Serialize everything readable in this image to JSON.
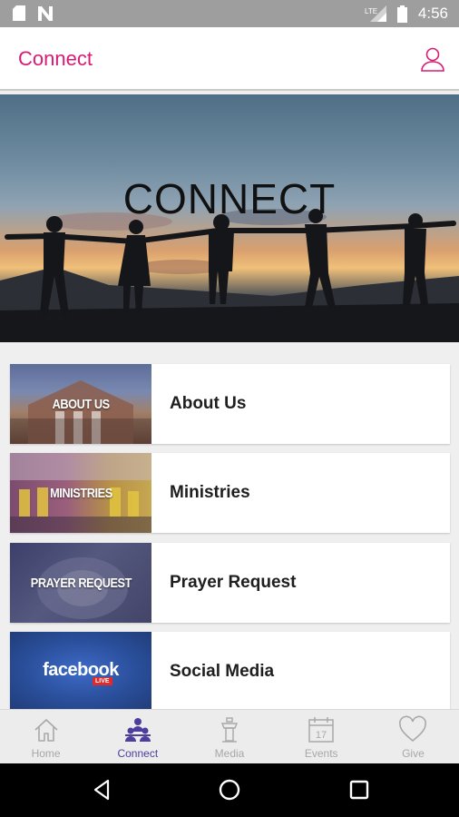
{
  "status_bar": {
    "time": "4:56",
    "network_label": "LTE"
  },
  "header": {
    "title": "Connect",
    "profile_icon": "person-outline-icon"
  },
  "hero": {
    "title": "CONNECT"
  },
  "cards": [
    {
      "thumb_text": "ABOUT US",
      "title": "About Us"
    },
    {
      "thumb_text": "MINISTRIES",
      "title": "Ministries"
    },
    {
      "thumb_text": "PRAYER REQUEST",
      "title": "Prayer Request"
    },
    {
      "thumb_text": "facebook",
      "thumb_badge": "LIVE",
      "title": "Social Media"
    }
  ],
  "bottom_nav": {
    "items": [
      {
        "label": "Home",
        "icon": "home-icon",
        "active": false
      },
      {
        "label": "Connect",
        "icon": "people-icon",
        "active": true
      },
      {
        "label": "Media",
        "icon": "podium-icon",
        "active": false
      },
      {
        "label": "Events",
        "icon": "calendar-icon",
        "day": "17",
        "active": false
      },
      {
        "label": "Give",
        "icon": "heart-icon",
        "active": false
      }
    ]
  },
  "colors": {
    "accent": "#d81b74",
    "nav_active": "#4d3e9e",
    "nav_inactive": "#a8a8a8"
  }
}
